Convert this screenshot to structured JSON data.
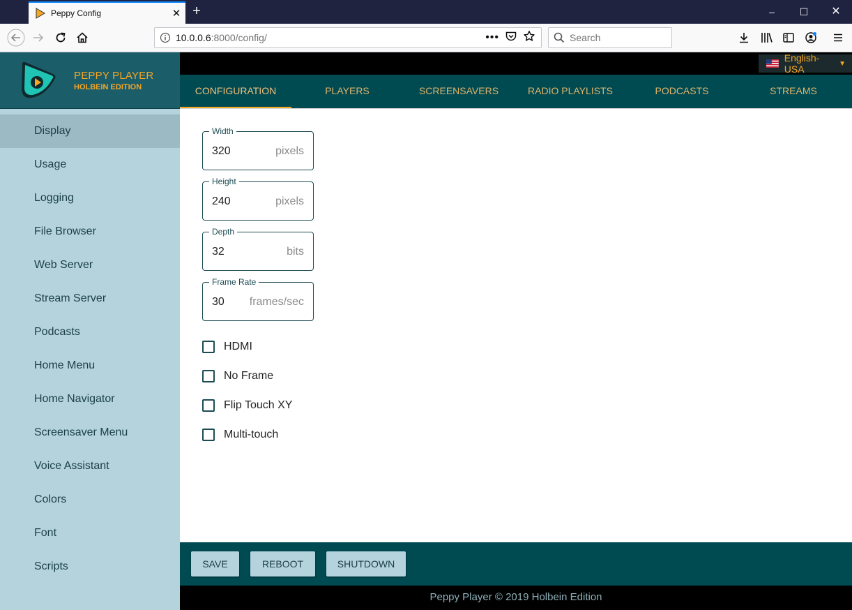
{
  "browser": {
    "tab_title": "Peppy Config",
    "url_host": "10.0.0.6",
    "url_rest": ":8000/config/",
    "search_placeholder": "Search",
    "icons": [
      "back-arrow-icon",
      "forward-arrow-icon",
      "reload-icon",
      "home-icon",
      "info-icon",
      "more-icon",
      "pocket-icon",
      "bookmark-star-icon",
      "search-icon",
      "download-icon",
      "library-icon",
      "sidebar-icon",
      "account-icon",
      "menu-icon"
    ]
  },
  "brand": {
    "name": "PEPPY PLAYER",
    "edition": "HOLBEIN EDITION",
    "accent": "#f5a623"
  },
  "language": {
    "selected": "English-USA"
  },
  "sidebar": {
    "items": [
      {
        "label": "Display"
      },
      {
        "label": "Usage"
      },
      {
        "label": "Logging"
      },
      {
        "label": "File Browser"
      },
      {
        "label": "Web Server"
      },
      {
        "label": "Stream Server"
      },
      {
        "label": "Podcasts"
      },
      {
        "label": "Home Menu"
      },
      {
        "label": "Home Navigator"
      },
      {
        "label": "Screensaver Menu"
      },
      {
        "label": "Voice Assistant"
      },
      {
        "label": "Colors"
      },
      {
        "label": "Font"
      },
      {
        "label": "Scripts"
      }
    ]
  },
  "tabs": [
    {
      "label": "CONFIGURATION"
    },
    {
      "label": "PLAYERS"
    },
    {
      "label": "SCREENSAVERS"
    },
    {
      "label": "RADIO PLAYLISTS"
    },
    {
      "label": "PODCASTS"
    },
    {
      "label": "STREAMS"
    }
  ],
  "fields": [
    {
      "label": "Width",
      "value": "320",
      "unit": "pixels"
    },
    {
      "label": "Height",
      "value": "240",
      "unit": "pixels"
    },
    {
      "label": "Depth",
      "value": "32",
      "unit": "bits"
    },
    {
      "label": "Frame Rate",
      "value": "30",
      "unit": "frames/sec"
    }
  ],
  "checkboxes": [
    {
      "label": "HDMI",
      "checked": false
    },
    {
      "label": "No Frame",
      "checked": false
    },
    {
      "label": "Flip Touch XY",
      "checked": false
    },
    {
      "label": "Multi-touch",
      "checked": false
    }
  ],
  "actions": {
    "save": "SAVE",
    "reboot": "REBOOT",
    "shutdown": "SHUTDOWN"
  },
  "footer": {
    "text": "Peppy Player © 2019 Holbein Edition"
  }
}
